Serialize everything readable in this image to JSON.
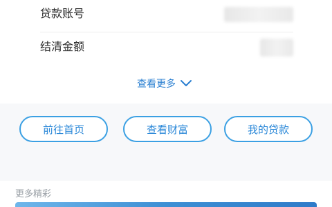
{
  "loan_info": {
    "rows": [
      {
        "label": "贷款账号"
      },
      {
        "label": "结清金额"
      }
    ],
    "see_more": {
      "label": "查看更多",
      "icon": "chevron-down-icon"
    }
  },
  "actions": {
    "buttons": [
      {
        "label": "前往首页"
      },
      {
        "label": "查看财富"
      },
      {
        "label": "我的贷款"
      }
    ]
  },
  "more_section": {
    "title": "更多精彩"
  },
  "colors": {
    "accent": "#2b88d8",
    "button_border": "#3ba0e3",
    "muted": "#9aa0a6",
    "band": "#f7f8fa"
  }
}
